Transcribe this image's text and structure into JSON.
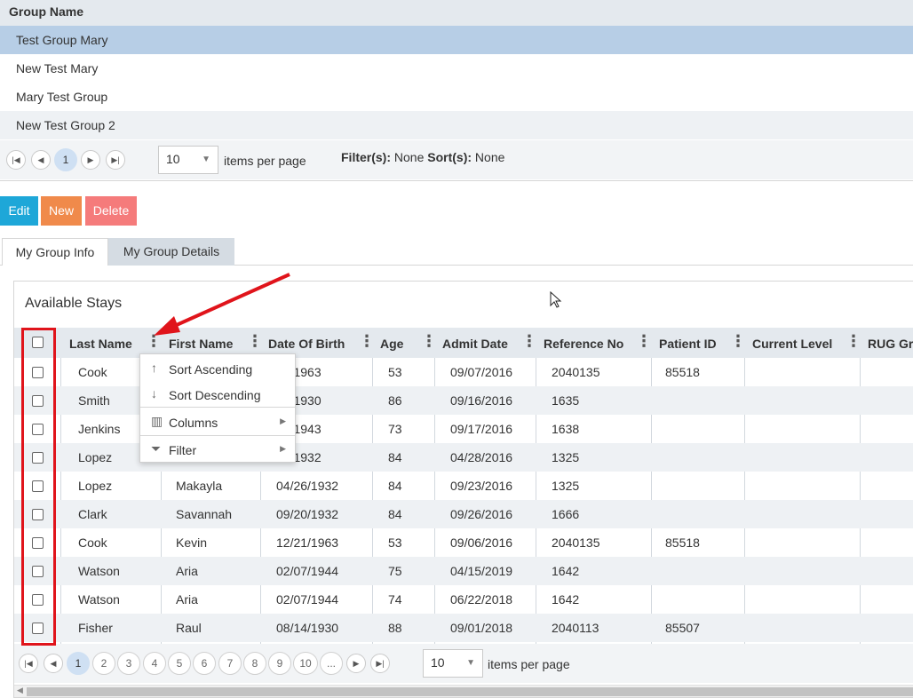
{
  "colors": {
    "edit": "#1ea7d8",
    "new": "#f08a4b",
    "delete": "#f57b7b",
    "selected_row": "#b7cee6",
    "annotation": "#e0141b"
  },
  "group_grid": {
    "header": "Group Name",
    "rows": [
      "Test Group Mary",
      "New Test Mary",
      "Mary Test Group",
      "New Test Group 2"
    ],
    "selected_index": 0,
    "pager": {
      "current_page": "1",
      "items_per_page": "10",
      "items_per_page_label": "items per page",
      "filters_label": "Filter(s):",
      "filters_value": "None",
      "sorts_label": "Sort(s):",
      "sorts_value": "None"
    }
  },
  "actions": {
    "edit": "Edit",
    "new": "New",
    "delete": "Delete"
  },
  "tabs": [
    {
      "label": "My Group Info",
      "active": true
    },
    {
      "label": "My Group Details",
      "active": false
    }
  ],
  "stays": {
    "title": "Available Stays",
    "columns": [
      "Last Name",
      "First Name",
      "Date Of Birth",
      "Age",
      "Admit Date",
      "Reference No",
      "Patient ID",
      "Current Level",
      "RUG Gro"
    ],
    "rows": [
      {
        "last": "Cook",
        "first": "",
        "dob": "21/1963",
        "age": "53",
        "admit": "09/07/2016",
        "ref": "2040135",
        "pid": "85518"
      },
      {
        "last": "Smith",
        "first": "",
        "dob": "01/1930",
        "age": "86",
        "admit": "09/16/2016",
        "ref": "1635",
        "pid": ""
      },
      {
        "last": "Jenkins",
        "first": "",
        "dob": "20/1943",
        "age": "73",
        "admit": "09/17/2016",
        "ref": "1638",
        "pid": ""
      },
      {
        "last": "Lopez",
        "first": "",
        "dob": "26/1932",
        "age": "84",
        "admit": "04/28/2016",
        "ref": "1325",
        "pid": ""
      },
      {
        "last": "Lopez",
        "first": "Makayla",
        "dob": "04/26/1932",
        "age": "84",
        "admit": "09/23/2016",
        "ref": "1325",
        "pid": ""
      },
      {
        "last": "Clark",
        "first": "Savannah",
        "dob": "09/20/1932",
        "age": "84",
        "admit": "09/26/2016",
        "ref": "1666",
        "pid": ""
      },
      {
        "last": "Cook",
        "first": "Kevin",
        "dob": "12/21/1963",
        "age": "53",
        "admit": "09/06/2016",
        "ref": "2040135",
        "pid": "85518"
      },
      {
        "last": "Watson",
        "first": "Aria",
        "dob": "02/07/1944",
        "age": "75",
        "admit": "04/15/2019",
        "ref": "1642",
        "pid": ""
      },
      {
        "last": "Watson",
        "first": "Aria",
        "dob": "02/07/1944",
        "age": "74",
        "admit": "06/22/2018",
        "ref": "1642",
        "pid": ""
      },
      {
        "last": "Fisher",
        "first": "Raul",
        "dob": "08/14/1930",
        "age": "88",
        "admit": "09/01/2018",
        "ref": "2040113",
        "pid": "85507"
      }
    ],
    "pager": {
      "pages": [
        "1",
        "2",
        "3",
        "4",
        "5",
        "6",
        "7",
        "8",
        "9",
        "10",
        "..."
      ],
      "current_page": "1",
      "items_per_page": "10",
      "items_per_page_label": "items per page"
    }
  },
  "column_menu": {
    "items": [
      {
        "label": "Sort Ascending",
        "icon": "sort-ascending-icon"
      },
      {
        "label": "Sort Descending",
        "icon": "sort-descending-icon"
      },
      {
        "label": "Columns",
        "icon": "columns-icon"
      },
      {
        "label": "Filter",
        "icon": "filter-icon"
      }
    ]
  }
}
